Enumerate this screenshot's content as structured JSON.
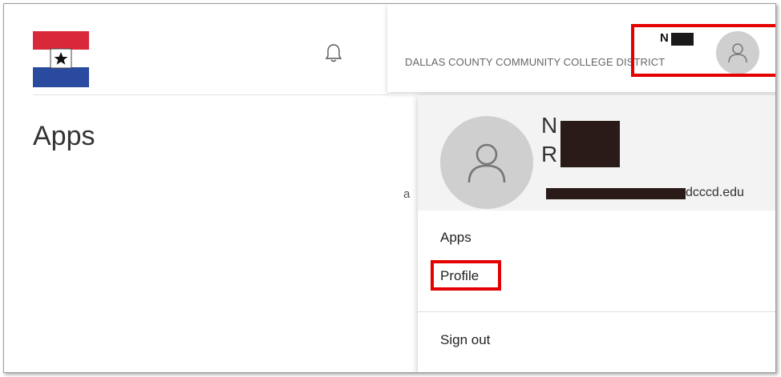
{
  "page": {
    "title": "Apps"
  },
  "org": {
    "name": "DALLAS COUNTY COMMUNITY COLLEGE DISTRICT"
  },
  "topbar": {
    "user_short": "N",
    "notification_icon": "bell-icon",
    "avatar_icon": "person-icon"
  },
  "user_menu": {
    "name_line1": "N",
    "name_line2": "R",
    "email_visible": "dcccd.edu",
    "items": [
      {
        "label": "Apps"
      },
      {
        "label": "Profile"
      },
      {
        "label": "Sign out"
      }
    ]
  },
  "colors": {
    "highlight": "#e40000",
    "logo_red": "#d8283a",
    "logo_blue": "#2a4aa0",
    "avatar_bg": "#cfcfcf"
  }
}
